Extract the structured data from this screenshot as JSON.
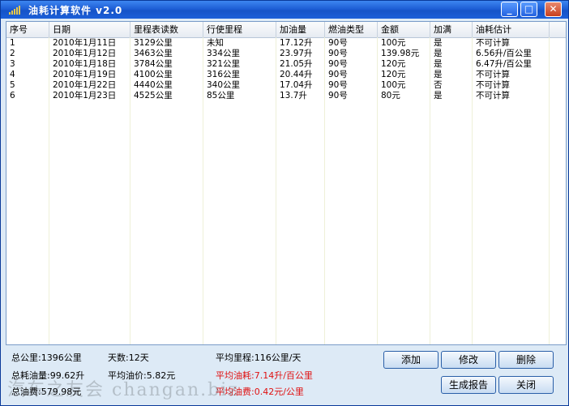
{
  "window": {
    "title": "油耗计算软件  v2.0",
    "minimize_label": "_",
    "maximize_label": "□",
    "close_label": "✕"
  },
  "table": {
    "columns": [
      "序号",
      "日期",
      "里程表读数",
      "行使里程",
      "加油量",
      "燃油类型",
      "金额",
      "加满",
      "油耗估计"
    ],
    "rows": [
      [
        "1",
        "2010年1月11日",
        "3129公里",
        "未知",
        "17.12升",
        "90号",
        "100元",
        "是",
        "不可计算"
      ],
      [
        "2",
        "2010年1月12日",
        "3463公里",
        "334公里",
        "23.97升",
        "90号",
        "139.98元",
        "是",
        "6.56升/百公里"
      ],
      [
        "3",
        "2010年1月18日",
        "3784公里",
        "321公里",
        "21.05升",
        "90号",
        "120元",
        "是",
        "6.47升/百公里"
      ],
      [
        "4",
        "2010年1月19日",
        "4100公里",
        "316公里",
        "20.44升",
        "90号",
        "120元",
        "是",
        "不可计算"
      ],
      [
        "5",
        "2010年1月22日",
        "4440公里",
        "340公里",
        "17.04升",
        "90号",
        "100元",
        "否",
        "不可计算"
      ],
      [
        "6",
        "2010年1月23日",
        "4525公里",
        "85公里",
        "13.7升",
        "90号",
        "80元",
        "是",
        "不可计算"
      ]
    ]
  },
  "summary": {
    "total_km": "总公里:1396公里",
    "days": "天数:12天",
    "avg_km": "平均里程:116公里/天",
    "total_fuel": "总耗油量:99.62升",
    "avg_price": "平均油价:5.82元",
    "avg_consumption": "平均油耗:7.14升/百公里",
    "total_cost": "总油费:579.98元",
    "avg_cost": "平均油费:0.42元/公里"
  },
  "buttons": {
    "add": "添加",
    "edit": "修改",
    "delete": "删除",
    "report": "生成报告",
    "close": "关闭"
  },
  "watermark": "汽车之友会  changan.biz",
  "colors": {
    "titlebar": "#1e5fd6",
    "window_bg": "#ddeaf6",
    "highlight": "#e01010"
  }
}
